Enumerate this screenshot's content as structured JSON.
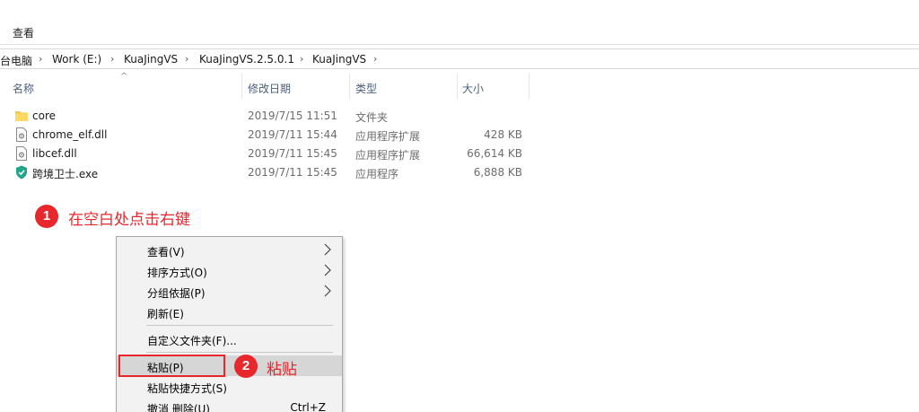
{
  "ribbon": {
    "view_tab": "查看"
  },
  "breadcrumb": {
    "items": [
      "台电脑",
      "Work (E:)",
      "KuaJingVS",
      "KuaJingVS.2.5.0.1",
      "KuaJingVS"
    ],
    "separator": "›"
  },
  "columns": {
    "name": "名称",
    "date": "修改日期",
    "type": "类型",
    "size": "大小"
  },
  "files": [
    {
      "name": "core",
      "date": "2019/7/15 11:51",
      "type": "文件夹",
      "size": "",
      "icon": "folder-icon"
    },
    {
      "name": "chrome_elf.dll",
      "date": "2019/7/11 15:44",
      "type": "应用程序扩展",
      "size": "428 KB",
      "icon": "dll-file-icon"
    },
    {
      "name": "libcef.dll",
      "date": "2019/7/11 15:45",
      "type": "应用程序扩展",
      "size": "66,614 KB",
      "icon": "dll-file-icon"
    },
    {
      "name": "跨境卫士.exe",
      "date": "2019/7/11 15:45",
      "type": "应用程序",
      "size": "6,888 KB",
      "icon": "app-shield-icon"
    }
  ],
  "annotations": {
    "step1_number": "1",
    "step1_text": "在空白处点击右键",
    "step2_number": "2",
    "step2_text": "粘贴"
  },
  "context_menu": {
    "items": [
      {
        "label": "查看(V)",
        "submenu": true
      },
      {
        "label": "排序方式(O)",
        "submenu": true
      },
      {
        "label": "分组依据(P)",
        "submenu": true
      },
      {
        "label": "刷新(E)",
        "submenu": false
      },
      {
        "label": "自定义文件夹(F)...",
        "submenu": false
      },
      {
        "label": "粘贴(P)",
        "submenu": false
      },
      {
        "label": "粘贴快捷方式(S)",
        "submenu": false
      },
      {
        "label": "撤消 删除(U)",
        "submenu": false,
        "shortcut": "Ctrl+Z"
      }
    ]
  },
  "colors": {
    "annotation_red": "#e8272c",
    "folder_yellow": "#f5c644",
    "header_text": "#4c607a"
  }
}
